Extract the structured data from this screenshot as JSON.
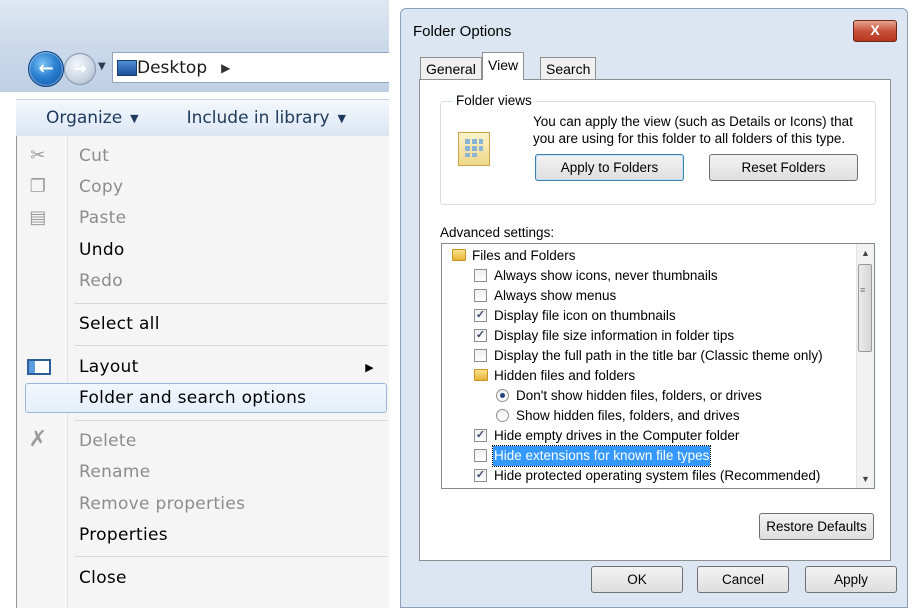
{
  "explorer": {
    "address": {
      "location": "Desktop"
    },
    "toolbar": {
      "organize": "Organize",
      "include_in_library": "Include in library"
    },
    "menu": {
      "cut": "Cut",
      "copy": "Copy",
      "paste": "Paste",
      "undo": "Undo",
      "redo": "Redo",
      "select_all": "Select all",
      "layout": "Layout",
      "folder_options": "Folder and search options",
      "delete": "Delete",
      "rename": "Rename",
      "remove_properties": "Remove properties",
      "properties": "Properties",
      "close": "Close"
    }
  },
  "dialog": {
    "title": "Folder Options",
    "close": "X",
    "tabs": {
      "general": "General",
      "view": "View",
      "search": "Search"
    },
    "folder_views": {
      "legend": "Folder views",
      "description": "You can apply the view (such as Details or Icons) that you are using for this folder to all folders of this type.",
      "apply_button": "Apply to Folders",
      "reset_button": "Reset Folders"
    },
    "advanced": {
      "label": "Advanced settings:",
      "items": [
        {
          "text": "Files and Folders",
          "kind": "folder",
          "indent": 0,
          "checked": false
        },
        {
          "text": "Always show icons, never thumbnails",
          "kind": "checkbox",
          "indent": 1,
          "checked": false
        },
        {
          "text": "Always show menus",
          "kind": "checkbox",
          "indent": 1,
          "checked": false
        },
        {
          "text": "Display file icon on thumbnails",
          "kind": "checkbox",
          "indent": 1,
          "checked": true
        },
        {
          "text": "Display file size information in folder tips",
          "kind": "checkbox",
          "indent": 1,
          "checked": true
        },
        {
          "text": "Display the full path in the title bar (Classic theme only)",
          "kind": "checkbox",
          "indent": 1,
          "checked": false
        },
        {
          "text": "Hidden files and folders",
          "kind": "folder",
          "indent": 1,
          "checked": false
        },
        {
          "text": "Don't show hidden files, folders, or drives",
          "kind": "radio",
          "indent": 2,
          "checked": true
        },
        {
          "text": "Show hidden files, folders, and drives",
          "kind": "radio",
          "indent": 2,
          "checked": false
        },
        {
          "text": "Hide empty drives in the Computer folder",
          "kind": "checkbox",
          "indent": 1,
          "checked": true
        },
        {
          "text": "Hide extensions for known file types",
          "kind": "checkbox",
          "indent": 1,
          "checked": false,
          "selected": true
        },
        {
          "text": "Hide protected operating system files (Recommended)",
          "kind": "checkbox",
          "indent": 1,
          "checked": true
        }
      ]
    },
    "restore_defaults": "Restore Defaults",
    "buttons": {
      "ok": "OK",
      "cancel": "Cancel",
      "apply": "Apply"
    }
  }
}
